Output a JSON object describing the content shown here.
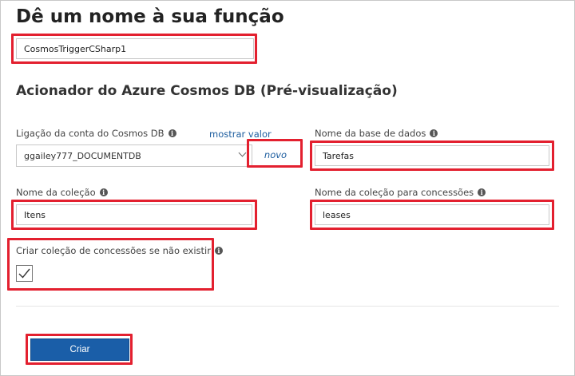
{
  "title": "Dê um nome à sua função",
  "function_name": "CosmosTriggerCSharp1",
  "subtitle": "Acionador do Azure Cosmos DB (Pré-visualização)",
  "account_connection": {
    "label": "Ligação da conta do Cosmos DB",
    "show_value_link": "mostrar valor",
    "value": "ggailey777_DOCUMENTDB",
    "new_link": "novo"
  },
  "database_name": {
    "label": "Nome da base de dados",
    "value": "Tarefas"
  },
  "collection_name": {
    "label": "Nome da coleção",
    "value": "Itens"
  },
  "lease_collection_name": {
    "label": "Nome da coleção para concessões",
    "value": "leases"
  },
  "create_lease_collection": {
    "label": "Criar coleção de concessões se não existir",
    "checked": true
  },
  "create_button": "Criar",
  "colors": {
    "highlight": "#e3202f",
    "primary_button": "#1a5ea8",
    "link": "#1b5c9e"
  },
  "icons": {
    "info": "info-icon",
    "dropdown": "chevron-down-icon",
    "check": "checkmark-icon"
  }
}
